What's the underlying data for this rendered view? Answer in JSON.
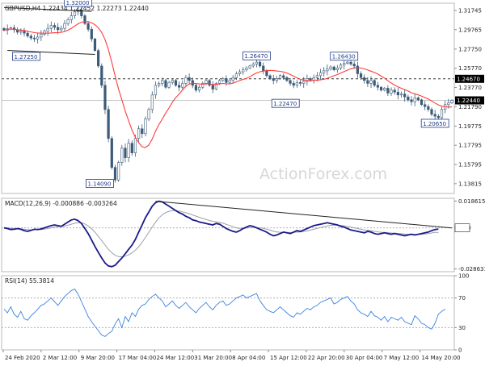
{
  "chart_data": [
    {
      "type": "candlestick",
      "panel": "price",
      "header": "GBPUSD,H4  1.22434 1.22452 1.22273 1.22440",
      "watermark": "ActionForex.com",
      "ylim": [
        1.128,
        1.325
      ],
      "y_ticks": [
        "1.31745",
        "1.29765",
        "1.27750",
        "1.25770",
        "1.23770",
        "1.21790",
        "1.19775",
        "1.17795",
        "1.15795",
        "1.13815"
      ],
      "current_price_label": "1.22440",
      "resistance_label": "1.24670",
      "resistance_value": 1.2467,
      "current_value": 1.2244,
      "annotations": [
        {
          "label": "1.32000",
          "value": 1.32,
          "x_index": 22
        },
        {
          "label": "1.27250",
          "value": 1.2725,
          "x_index": 3
        },
        {
          "label": "1.14090",
          "value": 1.1409,
          "x_index": 33
        },
        {
          "label": "1.26470",
          "value": 1.2647,
          "x_index": 75
        },
        {
          "label": "1.22470",
          "value": 1.2247,
          "x_index": 80
        },
        {
          "label": "1.26430",
          "value": 1.2643,
          "x_index": 101
        },
        {
          "label": "1.20650",
          "value": 1.2065,
          "x_index": 128
        }
      ],
      "moving_average_color": "#ff3b3b",
      "candle_color": "#3b5b78",
      "close_series": [
        1.297,
        1.2985,
        1.2995,
        1.2975,
        1.295,
        1.296,
        1.294,
        1.291,
        1.289,
        1.288,
        1.29,
        1.293,
        1.296,
        1.299,
        1.302,
        1.3,
        1.2975,
        1.299,
        1.304,
        1.308,
        1.312,
        1.316,
        1.318,
        1.312,
        1.304,
        1.298,
        1.288,
        1.276,
        1.26,
        1.24,
        1.215,
        1.185,
        1.155,
        1.142,
        1.16,
        1.175,
        1.165,
        1.18,
        1.17,
        1.185,
        1.195,
        1.19,
        1.205,
        1.215,
        1.23,
        1.24,
        1.242,
        1.245,
        1.238,
        1.243,
        1.245,
        1.24,
        1.238,
        1.242,
        1.248,
        1.245,
        1.24,
        1.235,
        1.238,
        1.242,
        1.245,
        1.24,
        1.236,
        1.242,
        1.245,
        1.247,
        1.243,
        1.245,
        1.248,
        1.252,
        1.254,
        1.256,
        1.258,
        1.26,
        1.262,
        1.264,
        1.26,
        1.255,
        1.25,
        1.247,
        1.245,
        1.247,
        1.25,
        1.248,
        1.245,
        1.242,
        1.24,
        1.243,
        1.242,
        1.244,
        1.247,
        1.245,
        1.248,
        1.25,
        1.253,
        1.255,
        1.257,
        1.259,
        1.256,
        1.258,
        1.261,
        1.263,
        1.264,
        1.262,
        1.26,
        1.252,
        1.248,
        1.245,
        1.242,
        1.245,
        1.24,
        1.238,
        1.235,
        1.237,
        1.232,
        1.235,
        1.233,
        1.23,
        1.231,
        1.228,
        1.225,
        1.223,
        1.227,
        1.225,
        1.22,
        1.218,
        1.215,
        1.21,
        1.208,
        1.2065,
        1.215,
        1.22,
        1.222,
        1.2244
      ]
    },
    {
      "type": "line",
      "panel": "macd",
      "header": "MACD(12,26,9) -0.000886 -0.003264",
      "ylim": [
        -0.0305,
        0.0205
      ],
      "y_ticks": [
        "0.018615",
        "0.00",
        "-0.028631"
      ],
      "series": [
        {
          "name": "MACD",
          "color": "#1a1a8c",
          "values": [
            0.0,
            -0.0005,
            -0.0012,
            -0.001,
            -0.0005,
            -0.001,
            -0.002,
            -0.0025,
            -0.0018,
            -0.001,
            -0.0012,
            -0.0008,
            0.0,
            0.0008,
            0.0015,
            0.002,
            0.0015,
            0.001,
            0.0025,
            0.004,
            0.0055,
            0.006,
            0.005,
            0.003,
            -0.0005,
            -0.004,
            -0.0085,
            -0.013,
            -0.017,
            -0.021,
            -0.0245,
            -0.0265,
            -0.027,
            -0.026,
            -0.0235,
            -0.021,
            -0.018,
            -0.015,
            -0.012,
            -0.008,
            -0.003,
            0.002,
            0.007,
            0.011,
            0.015,
            0.0175,
            0.0185,
            0.018,
            0.0165,
            0.015,
            0.0135,
            0.012,
            0.0105,
            0.0095,
            0.008,
            0.007,
            0.0055,
            0.005,
            0.004,
            0.0035,
            0.003,
            0.0025,
            0.002,
            0.003,
            0.0025,
            0.001,
            -0.0005,
            -0.0015,
            -0.0025,
            -0.003,
            -0.002,
            -0.0005,
            0.0005,
            0.0015,
            0.001,
            0.0,
            -0.001,
            -0.002,
            -0.003,
            -0.0045,
            -0.0055,
            -0.005,
            -0.004,
            -0.003,
            -0.0035,
            -0.004,
            -0.003,
            -0.002,
            -0.0025,
            -0.0015,
            -0.0005,
            0.0005,
            0.0015,
            0.002,
            0.0025,
            0.003,
            0.0035,
            0.003,
            0.0025,
            0.002,
            0.001,
            0.0005,
            -0.0005,
            -0.0015,
            -0.002,
            -0.0025,
            -0.003,
            -0.0035,
            -0.0025,
            -0.003,
            -0.004,
            -0.0045,
            -0.004,
            -0.0035,
            -0.004,
            -0.0045,
            -0.004,
            -0.0045,
            -0.005,
            -0.0055,
            -0.005,
            -0.0045,
            -0.005,
            -0.0045,
            -0.004,
            -0.0035,
            -0.003,
            -0.002,
            -0.0012,
            -0.0009
          ]
        },
        {
          "name": "Signal",
          "color": "#9aa0a6",
          "values": [
            0.0002,
            0.0,
            -0.0004,
            -0.0006,
            -0.0006,
            -0.0007,
            -0.001,
            -0.0013,
            -0.0014,
            -0.0013,
            -0.0013,
            -0.0012,
            -0.0009,
            -0.0005,
            0.0,
            0.0005,
            0.0008,
            0.0009,
            0.0012,
            0.0018,
            0.0025,
            0.0032,
            0.0036,
            0.0035,
            0.0027,
            0.0013,
            -0.0006,
            -0.0031,
            -0.0059,
            -0.0089,
            -0.012,
            -0.0149,
            -0.0173,
            -0.0191,
            -0.02,
            -0.0202,
            -0.0197,
            -0.0188,
            -0.0174,
            -0.0156,
            -0.0131,
            -0.0101,
            -0.0067,
            -0.0031,
            0.0005,
            0.0039,
            0.0069,
            0.0091,
            0.0106,
            0.0115,
            0.0119,
            0.0119,
            0.0116,
            0.0111,
            0.0105,
            0.0098,
            0.0089,
            0.0081,
            0.0073,
            0.0065,
            0.0058,
            0.0051,
            0.0045,
            0.0042,
            0.0038,
            0.0032,
            0.0024,
            0.0016,
            0.0008,
            0.0,
            -0.0004,
            -0.0004,
            -0.0002,
            0.0001,
            0.0003,
            0.0002,
            0.0,
            -0.0004,
            -0.0009,
            -0.0016,
            -0.0024,
            -0.0029,
            -0.0031,
            -0.0031,
            -0.0032,
            -0.0033,
            -0.0032,
            -0.003,
            -0.0029,
            -0.0026,
            -0.0022,
            -0.0016,
            -0.001,
            -0.0004,
            0.0002,
            0.0008,
            0.0013,
            0.0017,
            0.0019,
            0.0019,
            0.0017,
            0.0014,
            0.001,
            0.0005,
            0.0,
            -0.0005,
            -0.001,
            -0.0015,
            -0.0017,
            -0.002,
            -0.0024,
            -0.0028,
            -0.0031,
            -0.0032,
            -0.0034,
            -0.0036,
            -0.0037,
            -0.0039,
            -0.0041,
            -0.0044,
            -0.0045,
            -0.0045,
            -0.0046,
            -0.0046,
            -0.0045,
            -0.0043,
            -0.004,
            -0.0036,
            -0.0031,
            -0.0033
          ]
        }
      ],
      "trendline": {
        "from_index": 45,
        "from_value": 0.0185,
        "to_index": 133,
        "to_value": -0.0001
      }
    },
    {
      "type": "line",
      "panel": "rsi",
      "header": "RSI(14) 55.3814",
      "ylim": [
        0,
        100
      ],
      "y_ticks": [
        "100",
        "70",
        "30",
        "0"
      ],
      "levels": [
        70,
        30
      ],
      "series": [
        {
          "name": "RSI",
          "color": "#3b82e0",
          "values": [
            55,
            50,
            58,
            48,
            44,
            52,
            42,
            40,
            46,
            50,
            55,
            60,
            62,
            66,
            70,
            65,
            60,
            66,
            72,
            76,
            80,
            82,
            75,
            65,
            55,
            45,
            38,
            32,
            26,
            20,
            18,
            22,
            25,
            35,
            42,
            30,
            45,
            38,
            50,
            45,
            55,
            60,
            62,
            68,
            72,
            75,
            70,
            66,
            58,
            62,
            66,
            60,
            56,
            60,
            64,
            58,
            54,
            50,
            56,
            60,
            64,
            58,
            54,
            60,
            64,
            66,
            60,
            62,
            66,
            70,
            72,
            74,
            70,
            72,
            74,
            76,
            66,
            60,
            54,
            52,
            50,
            54,
            58,
            54,
            50,
            46,
            44,
            50,
            48,
            52,
            56,
            54,
            58,
            60,
            64,
            66,
            68,
            70,
            62,
            64,
            68,
            70,
            72,
            66,
            62,
            54,
            50,
            48,
            45,
            52,
            46,
            44,
            40,
            45,
            38,
            44,
            42,
            40,
            44,
            38,
            36,
            34,
            46,
            42,
            36,
            34,
            30,
            28,
            36,
            48,
            52,
            55
          ]
        }
      ]
    }
  ],
  "x_axis_labels": [
    "24 Feb 2020",
    "2 Mar 12:00",
    "9 Mar 20:00",
    "17 Mar 04:00",
    "24 Mar 12:00",
    "31 Mar 20:00",
    "8 Apr 04:00",
    "15 Apr 12:00",
    "22 Apr 20:00",
    "30 Apr 04:00",
    "7 May 12:00",
    "14 May 20:00"
  ]
}
